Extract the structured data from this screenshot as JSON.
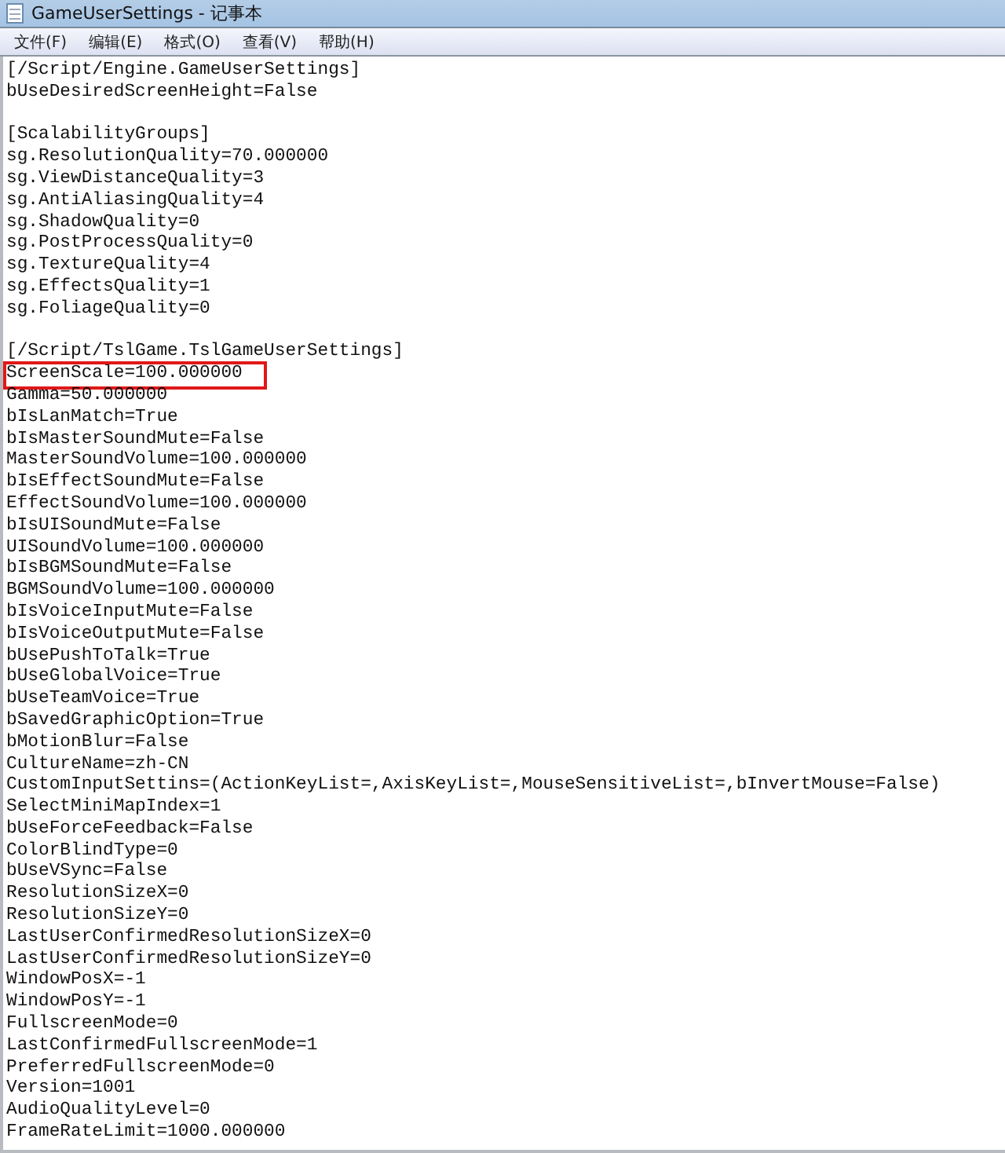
{
  "window": {
    "title": "GameUserSettings - 记事本"
  },
  "menu": [
    {
      "label": "文件(F)"
    },
    {
      "label": "编辑(E)"
    },
    {
      "label": "格式(O)"
    },
    {
      "label": "查看(V)"
    },
    {
      "label": "帮助(H)"
    }
  ],
  "sections": [
    {
      "lines": [
        {
          "text": "[/Script/Engine.GameUserSettings]",
          "highlighted": false
        },
        {
          "text": "bUseDesiredScreenHeight=False",
          "highlighted": false
        }
      ]
    },
    {
      "lines": [
        {
          "text": "[ScalabilityGroups]",
          "highlighted": false
        },
        {
          "text": "sg.ResolutionQuality=70.000000",
          "highlighted": false
        },
        {
          "text": "sg.ViewDistanceQuality=3",
          "highlighted": false
        },
        {
          "text": "sg.AntiAliasingQuality=4",
          "highlighted": false
        },
        {
          "text": "sg.ShadowQuality=0",
          "highlighted": false
        },
        {
          "text": "sg.PostProcessQuality=0",
          "highlighted": false
        },
        {
          "text": "sg.TextureQuality=4",
          "highlighted": false
        },
        {
          "text": "sg.EffectsQuality=1",
          "highlighted": false
        },
        {
          "text": "sg.FoliageQuality=0",
          "highlighted": false
        }
      ]
    },
    {
      "lines": [
        {
          "text": "[/Script/TslGame.TslGameUserSettings]",
          "highlighted": false
        },
        {
          "text": "ScreenScale=100.000000",
          "highlighted": true
        },
        {
          "text": "Gamma=50.000000",
          "highlighted": false
        },
        {
          "text": "bIsLanMatch=True",
          "highlighted": false
        },
        {
          "text": "bIsMasterSoundMute=False",
          "highlighted": false
        },
        {
          "text": "MasterSoundVolume=100.000000",
          "highlighted": false
        },
        {
          "text": "bIsEffectSoundMute=False",
          "highlighted": false
        },
        {
          "text": "EffectSoundVolume=100.000000",
          "highlighted": false
        },
        {
          "text": "bIsUISoundMute=False",
          "highlighted": false
        },
        {
          "text": "UISoundVolume=100.000000",
          "highlighted": false
        },
        {
          "text": "bIsBGMSoundMute=False",
          "highlighted": false
        },
        {
          "text": "BGMSoundVolume=100.000000",
          "highlighted": false
        },
        {
          "text": "bIsVoiceInputMute=False",
          "highlighted": false
        },
        {
          "text": "bIsVoiceOutputMute=False",
          "highlighted": false
        },
        {
          "text": "bUsePushToTalk=True",
          "highlighted": false
        },
        {
          "text": "bUseGlobalVoice=True",
          "highlighted": false
        },
        {
          "text": "bUseTeamVoice=True",
          "highlighted": false
        },
        {
          "text": "bSavedGraphicOption=True",
          "highlighted": false
        },
        {
          "text": "bMotionBlur=False",
          "highlighted": false
        },
        {
          "text": "CultureName=zh-CN",
          "highlighted": false
        },
        {
          "text": "CustomInputSettins=(ActionKeyList=,AxisKeyList=,MouseSensitiveList=,bInvertMouse=False)",
          "highlighted": false
        },
        {
          "text": "SelectMiniMapIndex=1",
          "highlighted": false
        },
        {
          "text": "bUseForceFeedback=False",
          "highlighted": false
        },
        {
          "text": "ColorBlindType=0",
          "highlighted": false
        },
        {
          "text": "bUseVSync=False",
          "highlighted": false
        },
        {
          "text": "ResolutionSizeX=0",
          "highlighted": false
        },
        {
          "text": "ResolutionSizeY=0",
          "highlighted": false
        },
        {
          "text": "LastUserConfirmedResolutionSizeX=0",
          "highlighted": false
        },
        {
          "text": "LastUserConfirmedResolutionSizeY=0",
          "highlighted": false
        },
        {
          "text": "WindowPosX=-1",
          "highlighted": false
        },
        {
          "text": "WindowPosY=-1",
          "highlighted": false
        },
        {
          "text": "FullscreenMode=0",
          "highlighted": false
        },
        {
          "text": "LastConfirmedFullscreenMode=1",
          "highlighted": false
        },
        {
          "text": "PreferredFullscreenMode=0",
          "highlighted": false
        },
        {
          "text": "Version=1001",
          "highlighted": false
        },
        {
          "text": "AudioQualityLevel=0",
          "highlighted": false
        },
        {
          "text": "FrameRateLimit=1000.000000",
          "highlighted": false
        }
      ]
    }
  ]
}
